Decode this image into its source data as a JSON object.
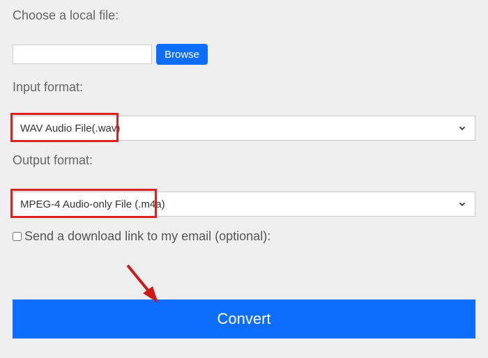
{
  "labels": {
    "choose_file": "Choose a local file:",
    "input_format": "Input format:",
    "output_format": "Output format:",
    "checkbox": "Send a download link to my email (optional):"
  },
  "buttons": {
    "browse": "Browse",
    "convert": "Convert"
  },
  "selects": {
    "input_format_value": "WAV Audio File(.wav)",
    "output_format_value": "MPEG-4 Audio-only File (.m4a)"
  },
  "file_input_value": ""
}
